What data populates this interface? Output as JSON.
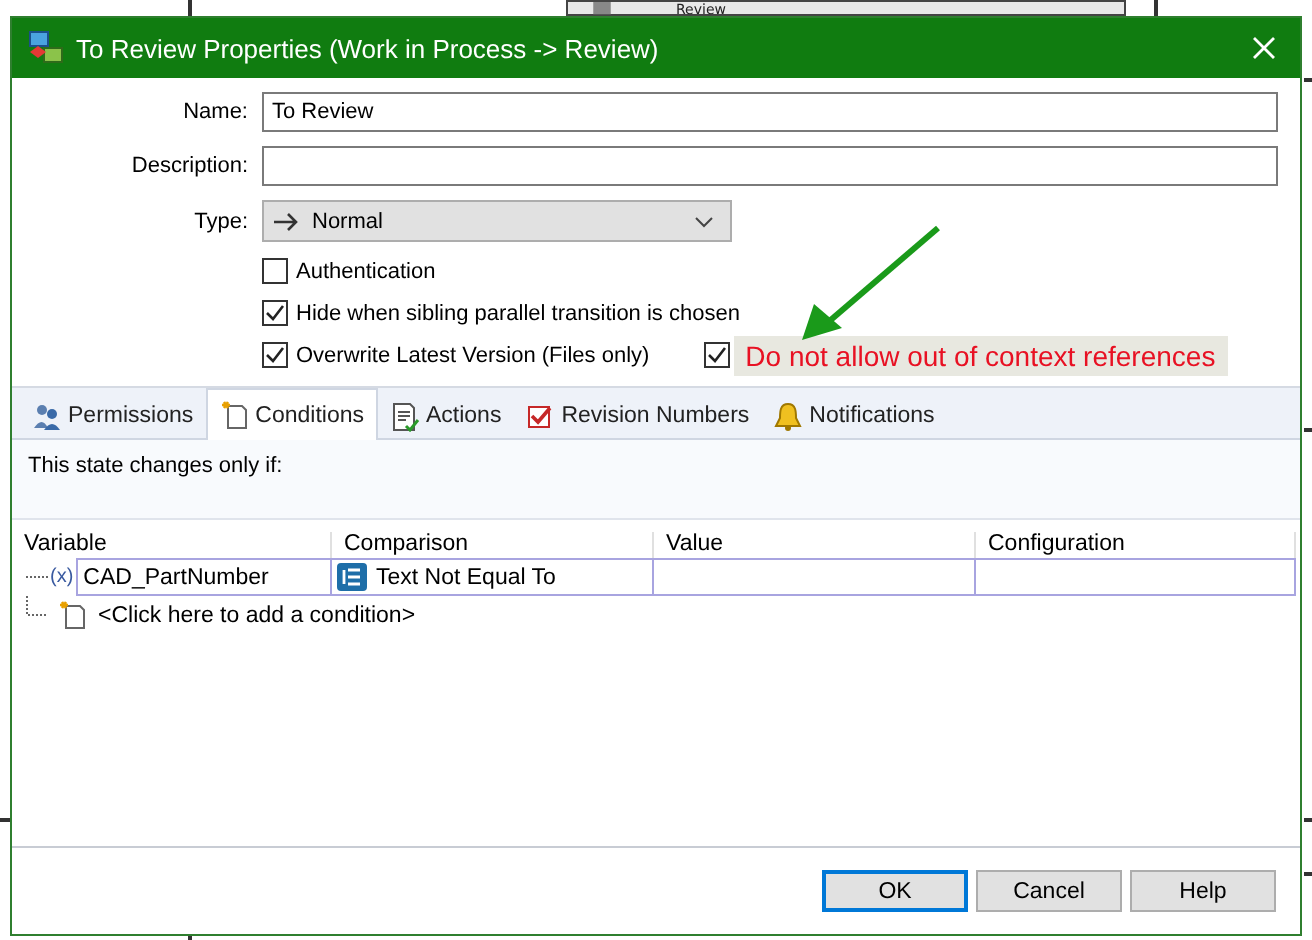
{
  "background": {
    "node": {
      "label": "Review"
    }
  },
  "window": {
    "title": "To Review Properties (Work in Process -> Review)"
  },
  "fields": [
    {
      "kind": "text",
      "label": "Name:",
      "value": "To Review"
    },
    {
      "kind": "text",
      "label": "Description:"
    },
    {
      "kind": "select",
      "label": "Type:",
      "value": "Normal"
    }
  ],
  "options": [
    {
      "label": "Authentication",
      "checked": false
    },
    {
      "label": "Hide when sibling parallel transition is chosen",
      "checked": true
    },
    {
      "label": "Overwrite Latest Version (Files only)",
      "checked": true
    }
  ],
  "annotated_option": {
    "checked": true,
    "callout": "Do not allow out of context references"
  },
  "tabs": [
    {
      "label": "Permissions",
      "selected": false
    },
    {
      "label": "Conditions",
      "selected": true
    },
    {
      "label": "Actions",
      "selected": false
    },
    {
      "label": "Revision Numbers",
      "selected": false
    },
    {
      "label": "Notifications",
      "selected": false
    }
  ],
  "instruction": "This state changes only if:",
  "table": {
    "columns": [
      "Variable",
      "Comparison",
      "Value",
      "Configuration"
    ],
    "rows": [
      {
        "marker": "(x)",
        "variable": "CAD_PartNumber",
        "comparison": "Text Not Equal To"
      }
    ],
    "add_row": "<Click here to add a condition>"
  },
  "buttons": [
    {
      "label": "OK",
      "default": true
    },
    {
      "label": "Cancel",
      "default": false
    },
    {
      "label": "Help",
      "default": false
    }
  ]
}
